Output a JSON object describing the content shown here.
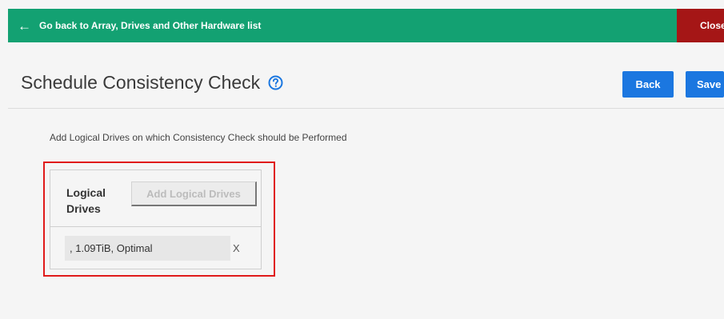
{
  "topbar": {
    "back_link_label": "Go back to Array, Drives and Other Hardware list",
    "back_arrow": "←",
    "close_label": "Close",
    "bg_color": "#13a172",
    "close_bg_color": "#a51616"
  },
  "page": {
    "title": "Schedule Consistency Check",
    "help_icon": "help-circle-icon",
    "back_button": "Back",
    "save_button": "Save",
    "button_color": "#1b77e0"
  },
  "content": {
    "instruction": "Add Logical Drives on which Consistency Check should be Performed",
    "logical_drives_label": "Logical Drives",
    "add_button": "Add Logical Drives",
    "drives": [
      {
        "value": ", 1.09TiB, Optimal",
        "remove_label": "X"
      }
    ]
  }
}
